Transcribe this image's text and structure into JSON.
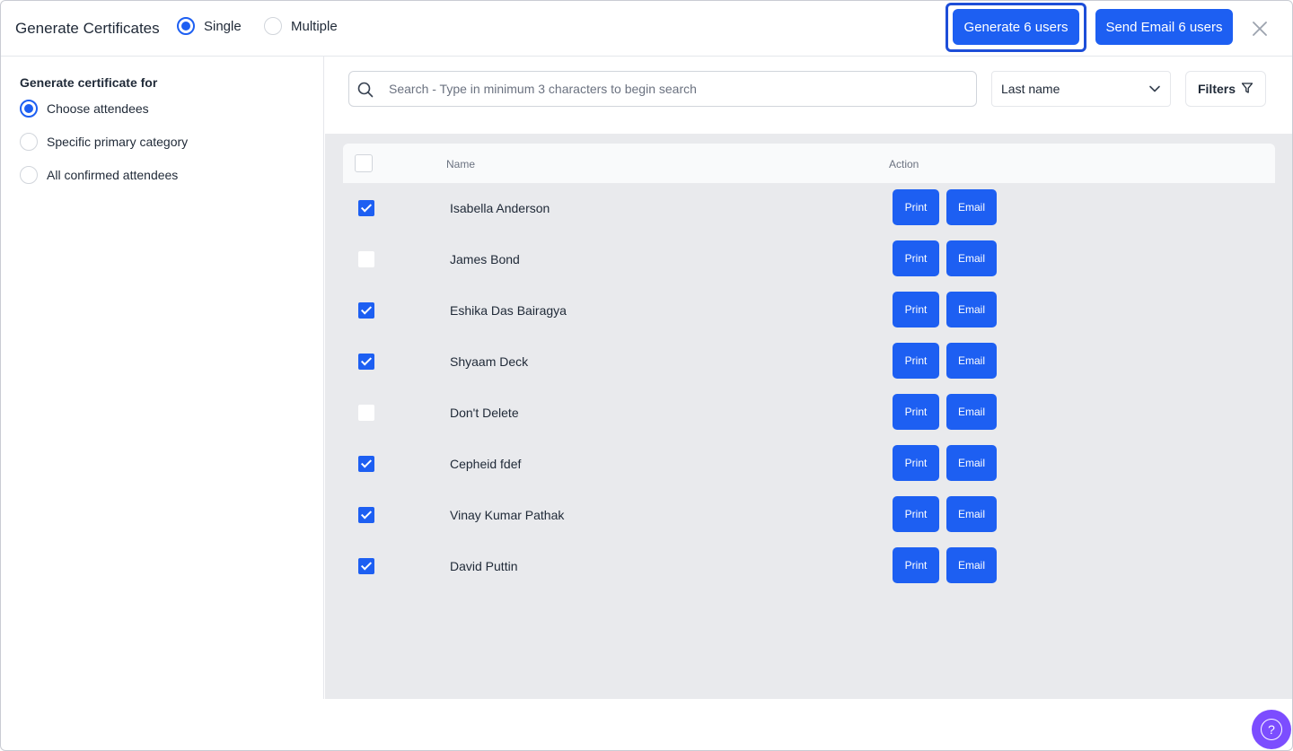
{
  "header": {
    "title": "Generate Certificates",
    "mode_options": [
      {
        "label": "Single",
        "checked": true
      },
      {
        "label": "Multiple",
        "checked": false
      }
    ],
    "generate_label": "Generate 6 users",
    "send_email_label": "Send Email 6 users",
    "close_icon": "close-icon"
  },
  "left": {
    "heading": "Generate certificate for",
    "options": [
      {
        "label": "Choose attendees",
        "checked": true
      },
      {
        "label": "Specific primary category",
        "checked": false
      },
      {
        "label": "All confirmed attendees",
        "checked": false
      }
    ]
  },
  "toolbar": {
    "search_placeholder": "Search - Type in minimum 3 characters to begin search",
    "search_value": "",
    "sort_value": "Last name",
    "filters_label": "Filters"
  },
  "table": {
    "columns": {
      "name": "Name",
      "action": "Action"
    },
    "print_label": "Print",
    "email_label": "Email",
    "rows": [
      {
        "name": "Isabella Anderson",
        "checked": true
      },
      {
        "name": "James Bond",
        "checked": false
      },
      {
        "name": "Eshika Das Bairagya",
        "checked": true
      },
      {
        "name": "Shyaam Deck",
        "checked": true
      },
      {
        "name": "Don't Delete",
        "checked": false
      },
      {
        "name": "Cepheid fdef",
        "checked": true
      },
      {
        "name": "Vinay Kumar Pathak",
        "checked": true
      },
      {
        "name": "David Puttin",
        "checked": true
      }
    ]
  },
  "help_label": "?",
  "colors": {
    "primary": "#1d5ff2",
    "help": "#7c4dff",
    "table_bg": "#e9eaed"
  }
}
